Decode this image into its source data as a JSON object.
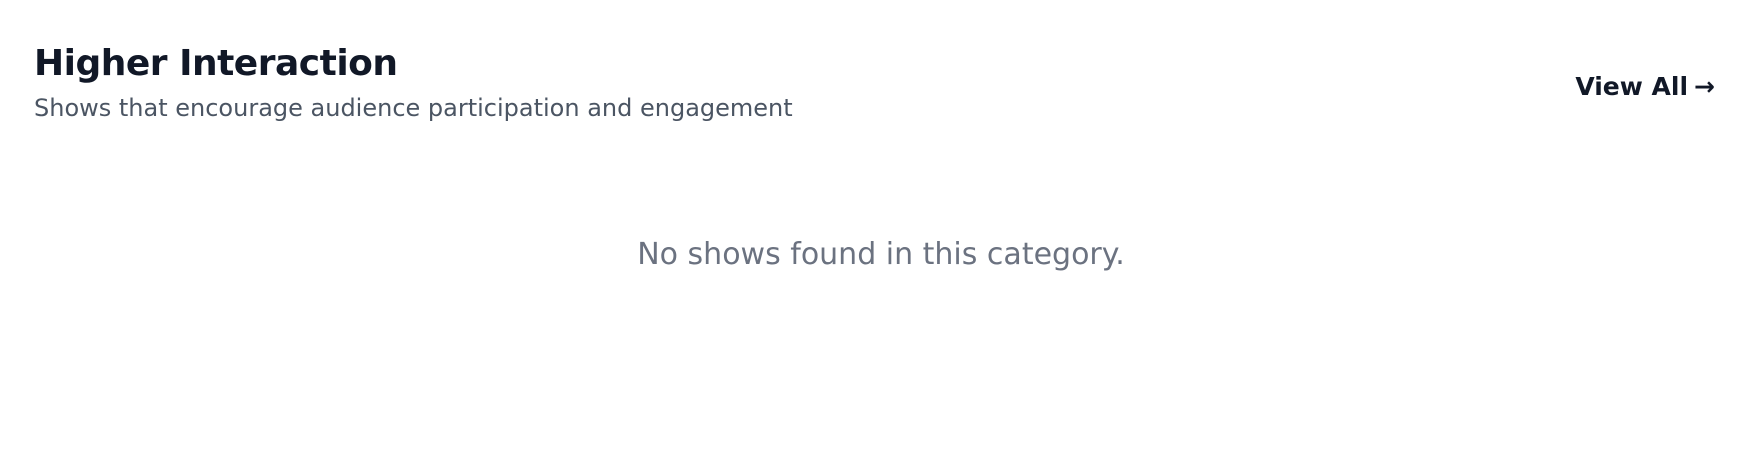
{
  "section": {
    "title": "Higher Interaction",
    "subtitle": "Shows that encourage audience participation and engagement",
    "view_all_label": "View All",
    "view_all_arrow": "→",
    "empty_message": "No shows found in this category."
  },
  "colors": {
    "title": "#111827",
    "subtitle": "#4b5563",
    "empty": "#6b7280",
    "background": "#ffffff"
  },
  "icons": {
    "view_all": "arrow-right-icon"
  }
}
